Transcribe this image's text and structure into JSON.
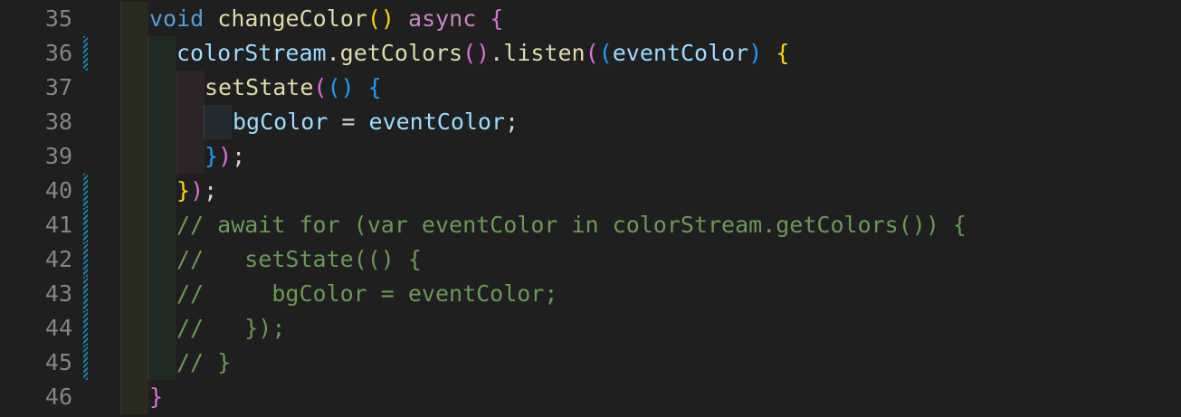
{
  "editor": {
    "lines": [
      {
        "number": "35",
        "tokens": [
          "void",
          " ",
          "changeColor",
          "()",
          " ",
          "async",
          " ",
          "{"
        ]
      },
      {
        "number": "36",
        "tokens": [
          "colorStream",
          ".",
          "getColors",
          "()",
          ".",
          "listen",
          "(",
          "(",
          "eventColor",
          ")",
          " ",
          "{"
        ]
      },
      {
        "number": "37",
        "tokens": [
          "setState",
          "(",
          "()",
          " ",
          "{"
        ]
      },
      {
        "number": "38",
        "tokens": [
          "bgColor",
          " = ",
          "eventColor",
          ";"
        ]
      },
      {
        "number": "39",
        "tokens": [
          "}",
          ")",
          ";"
        ]
      },
      {
        "number": "40",
        "tokens": [
          "}",
          ")",
          ";"
        ]
      },
      {
        "number": "41",
        "text": "// await for (var eventColor in colorStream.getColors()) {"
      },
      {
        "number": "42",
        "text": "//   setState(() {"
      },
      {
        "number": "43",
        "text": "//     bgColor = eventColor;"
      },
      {
        "number": "44",
        "text": "//   });"
      },
      {
        "number": "45",
        "text": "// }"
      },
      {
        "number": "46",
        "tokens": [
          "}"
        ]
      }
    ]
  },
  "colors": {
    "background": "#1f1f1f",
    "line_number": "#858585",
    "keyword": "#569cd6",
    "control_keyword": "#c586c0",
    "function": "#dcdcaa",
    "variable": "#9cdcfe",
    "comment": "#6a9955",
    "bracket_gold": "#ffd700",
    "bracket_pink": "#da70d6",
    "bracket_blue": "#179fff",
    "modified_marker": "#1b81a8"
  }
}
